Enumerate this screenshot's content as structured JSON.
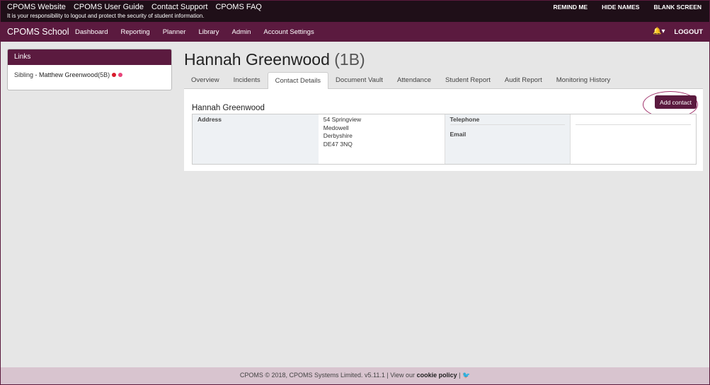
{
  "topbar": {
    "links": [
      "CPOMS Website",
      "CPOMS User Guide",
      "Contact Support",
      "CPOMS FAQ"
    ],
    "notice": "It is your responsibility to logout and protect the security of student information.",
    "remind": "REMIND ME",
    "hide": "HIDE NAMES",
    "blank": "BLANK SCREEN"
  },
  "nav": {
    "brand": "CPOMS School",
    "items": [
      "Dashboard",
      "Reporting",
      "Planner",
      "Library",
      "Admin",
      "Account Settings"
    ],
    "bell": "🔔▾",
    "logout": "LOGOUT"
  },
  "links_panel": {
    "title": "Links",
    "prefix": "Sibling - ",
    "sibling_name": "Matthew Greenwood",
    "sibling_form": " (5B)",
    "dot_colors": [
      "#d81b2b",
      "#e8457a"
    ]
  },
  "student": {
    "name": "Hannah Greenwood",
    "form": "(1B)"
  },
  "tabs": [
    "Overview",
    "Incidents",
    "Contact Details",
    "Document Vault",
    "Attendance",
    "Student Report",
    "Audit Report",
    "Monitoring History"
  ],
  "active_tab": "Contact Details",
  "contact": {
    "add_button": "Add contact",
    "name": "Hannah Greenwood",
    "address_label": "Address",
    "address_lines": [
      "54 Springview",
      "Medowell",
      "Derbyshire",
      "DE47 3NQ"
    ],
    "telephone_label": "Telephone",
    "email_label": "Email"
  },
  "footer": {
    "text": "CPOMS © 2018, CPOMS Systems Limited. v5.11.1 | View our ",
    "cookie": "cookie policy",
    "sep": " | ",
    "twitter": "🐦"
  }
}
